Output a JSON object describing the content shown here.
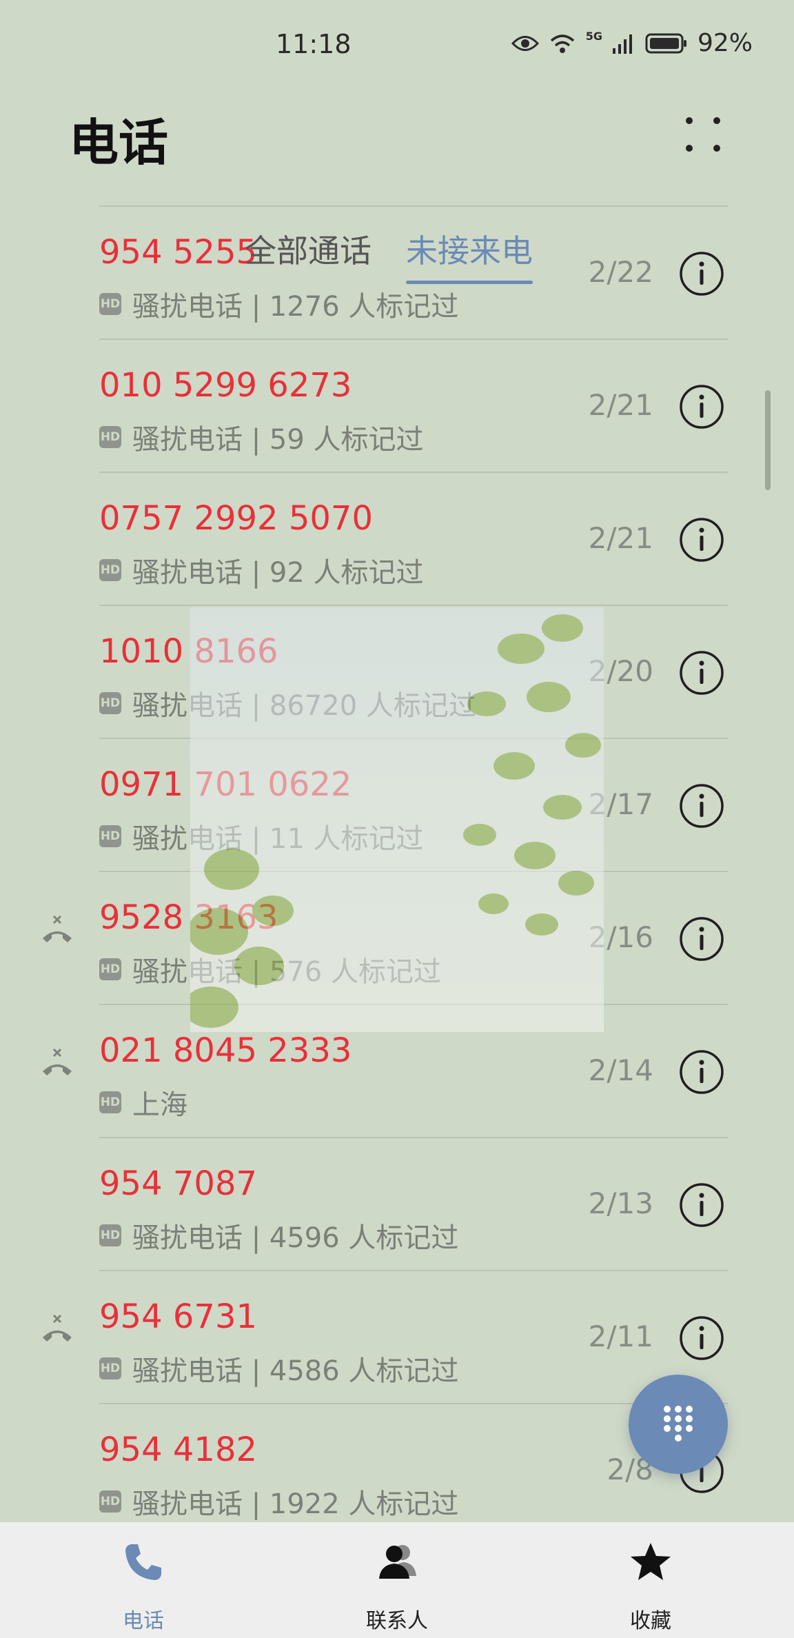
{
  "status_bar": {
    "time": "11:18",
    "battery": "92%",
    "network": "5G"
  },
  "header": {
    "title": "电话",
    "more_icon": "more-dots-icon"
  },
  "tabs": [
    {
      "label": "全部通话",
      "active": false
    },
    {
      "label": "未接来电",
      "active": true
    }
  ],
  "calls": [
    {
      "number": "954 5255",
      "detail": "骚扰电话 | 1276 人标记过",
      "date": "2/22",
      "missed_icon": false
    },
    {
      "number": "010 5299 6273",
      "detail": "骚扰电话 | 59 人标记过",
      "date": "2/21",
      "missed_icon": false
    },
    {
      "number": "0757 2992 5070",
      "detail": "骚扰电话 | 92 人标记过",
      "date": "2/21",
      "missed_icon": false
    },
    {
      "number": "1010 8166",
      "detail": "骚扰电话 | 86720 人标记过",
      "date": "2/20",
      "missed_icon": false
    },
    {
      "number": "0971 701 0622",
      "detail": "骚扰电话 | 11 人标记过",
      "date": "2/17",
      "missed_icon": false
    },
    {
      "number": "9528 3163",
      "detail": "骚扰电话 | 576 人标记过",
      "date": "2/16",
      "missed_icon": true
    },
    {
      "number": "021 8045 2333",
      "detail": "上海",
      "date": "2/14",
      "missed_icon": true
    },
    {
      "number": "954 7087",
      "detail": "骚扰电话 | 4596 人标记过",
      "date": "2/13",
      "missed_icon": false
    },
    {
      "number": "954 6731",
      "detail": "骚扰电话 | 4586 人标记过",
      "date": "2/11",
      "missed_icon": true
    },
    {
      "number": "954 4182",
      "detail": "骚扰电话 | 1922 人标记过",
      "date": "2/8",
      "missed_icon": false
    }
  ],
  "hd_badge": "HD",
  "fab": {
    "icon": "dialpad-icon"
  },
  "bottom_nav": [
    {
      "label": "电话",
      "icon": "phone-icon",
      "active": true
    },
    {
      "label": "联系人",
      "icon": "contacts-icon",
      "active": false
    },
    {
      "label": "收藏",
      "icon": "star-icon",
      "active": false
    }
  ],
  "colors": {
    "accent": "#6b8ab5",
    "missed_red": "#e8303a",
    "background": "#cfd9c7"
  }
}
